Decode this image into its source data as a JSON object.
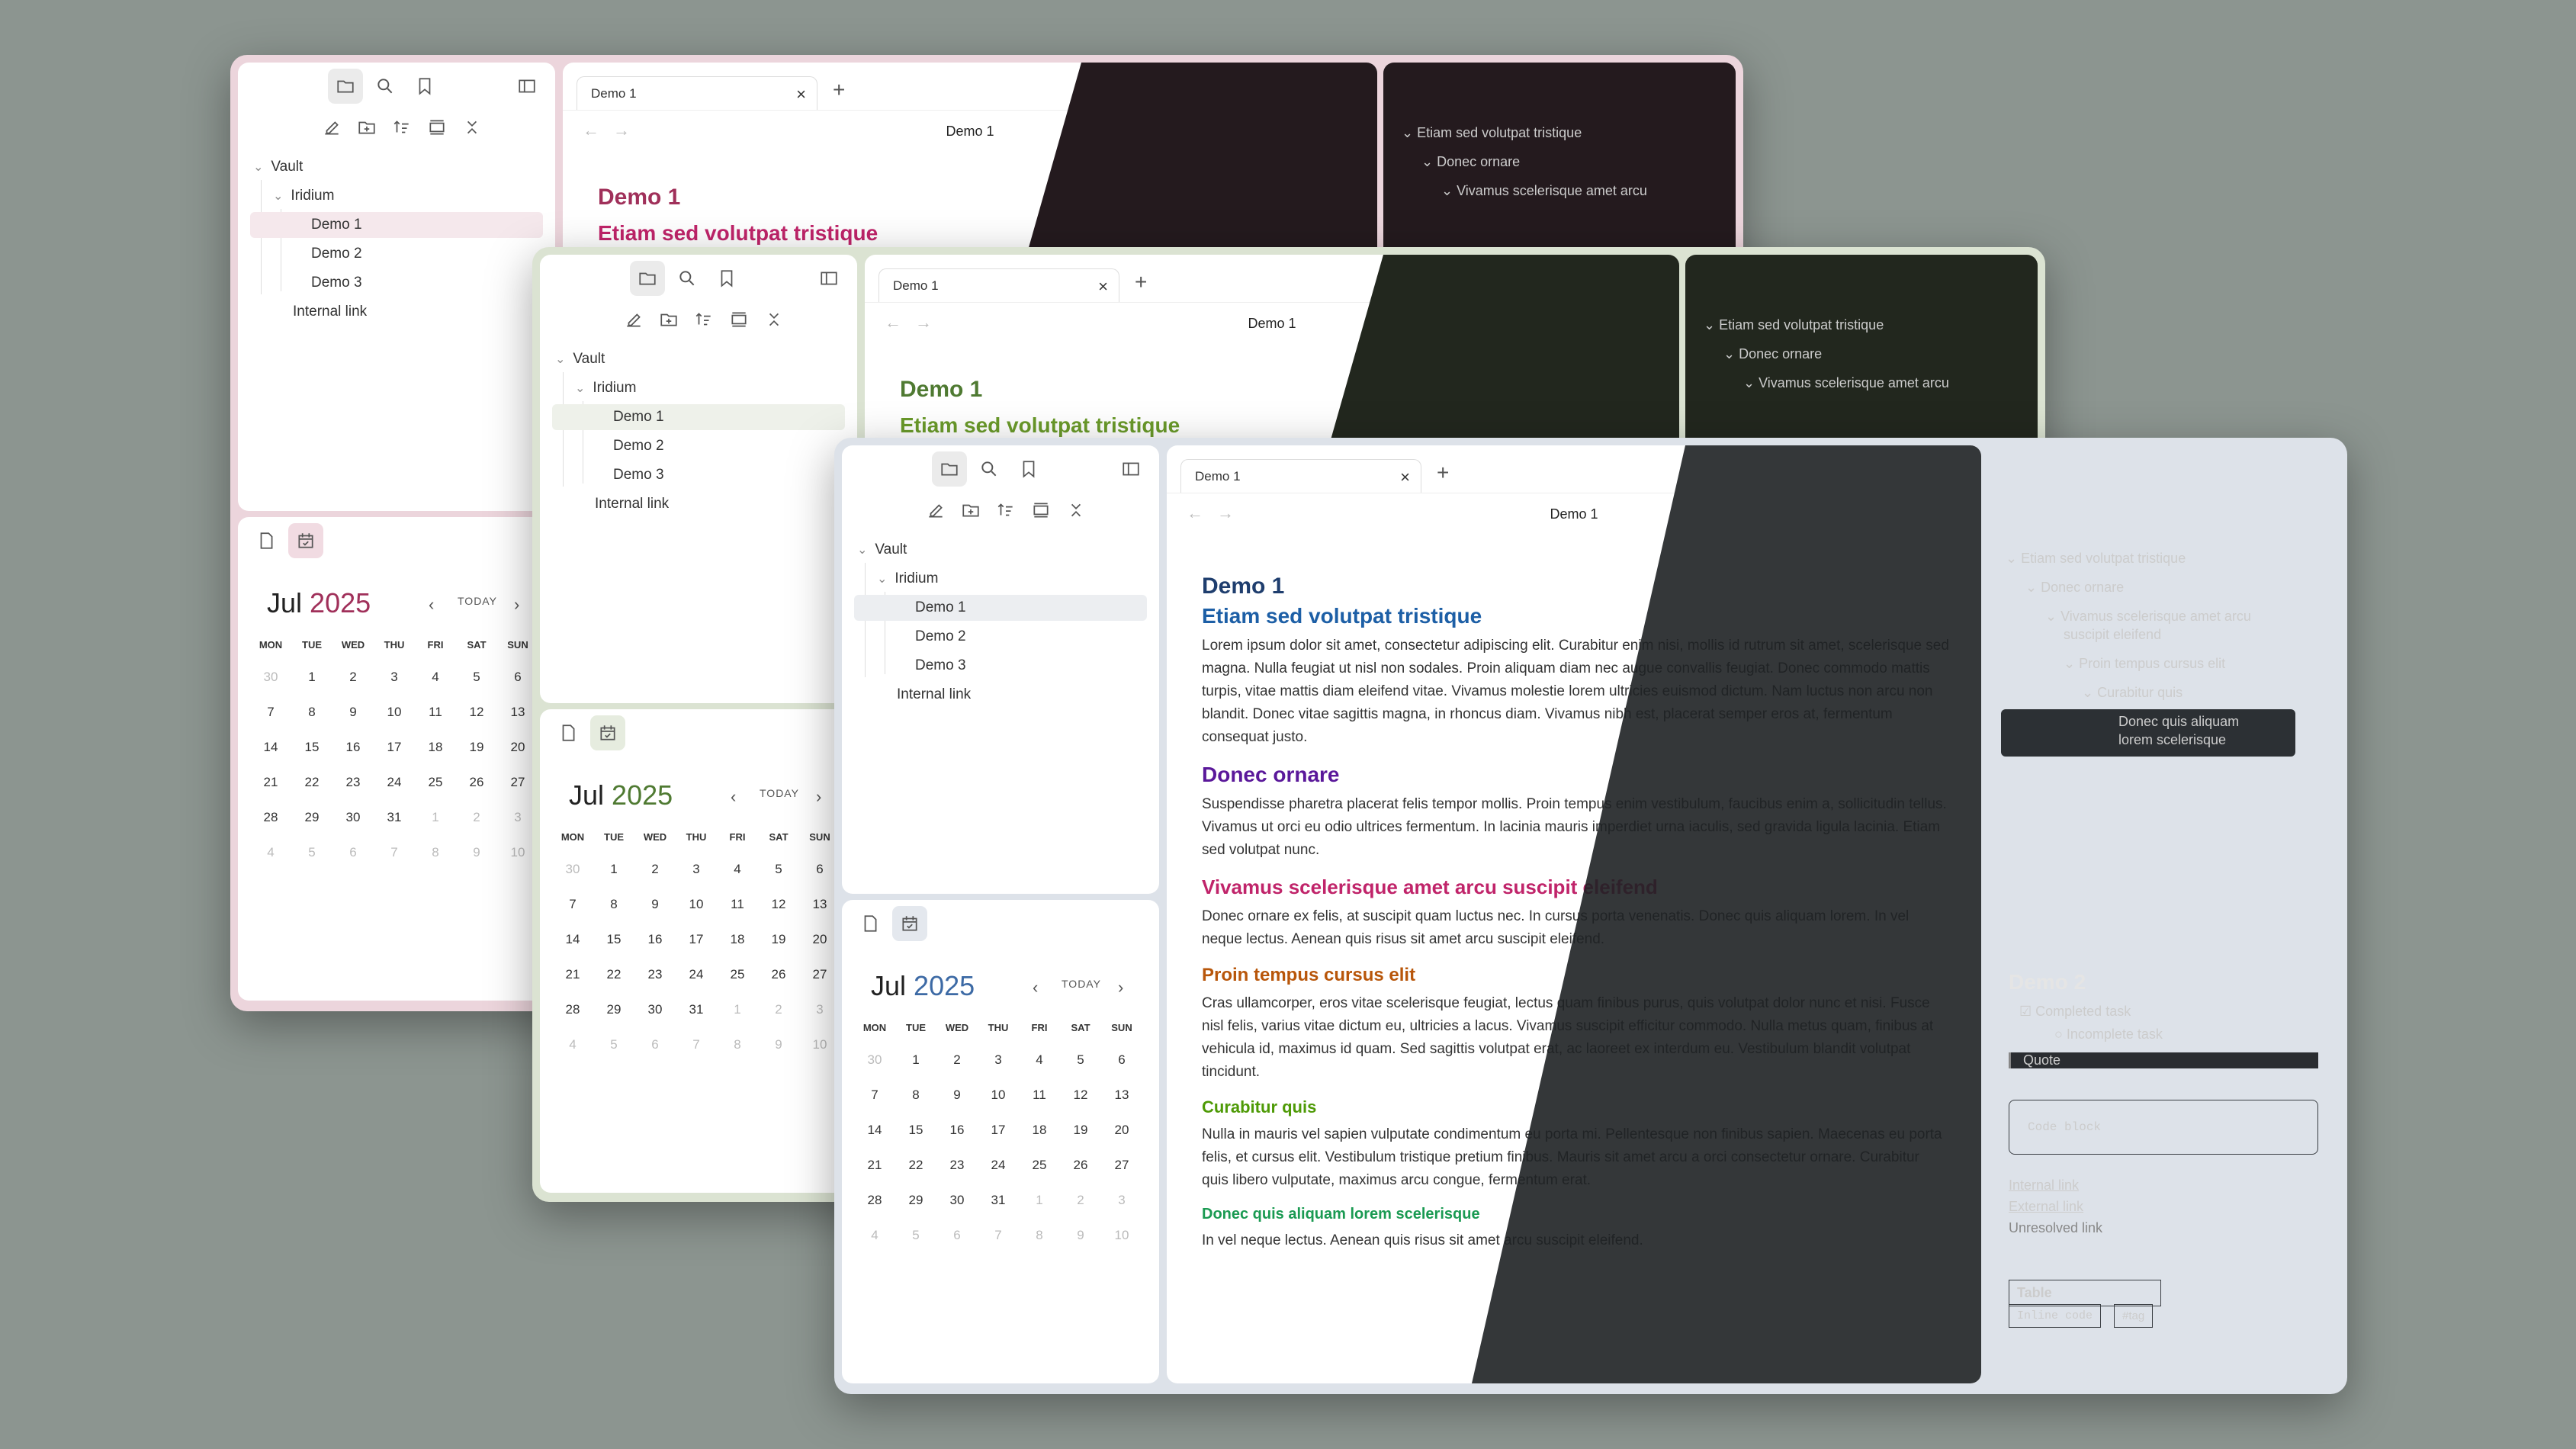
{
  "tab_label": "Demo 1",
  "crumb": "Demo 1",
  "tree": {
    "vault": "Vault",
    "iridium": "Iridium",
    "demo1": "Demo 1",
    "demo2": "Demo 2",
    "demo3": "Demo 3",
    "internal_link": "Internal link"
  },
  "calendar": {
    "month": "Jul",
    "year": "2025",
    "today": "TODAY",
    "days": [
      "MON",
      "TUE",
      "WED",
      "THU",
      "FRI",
      "SAT",
      "SUN"
    ],
    "weeks": [
      [
        "30",
        "1",
        "2",
        "3",
        "4",
        "5",
        "6"
      ],
      [
        "7",
        "8",
        "9",
        "10",
        "11",
        "12",
        "13"
      ],
      [
        "14",
        "15",
        "16",
        "17",
        "18",
        "19",
        "20"
      ],
      [
        "21",
        "22",
        "23",
        "24",
        "25",
        "26",
        "27"
      ],
      [
        "28",
        "29",
        "30",
        "31",
        "1",
        "2",
        "3"
      ],
      [
        "4",
        "5",
        "6",
        "7",
        "8",
        "9",
        "10"
      ]
    ]
  },
  "doc": {
    "title": "Demo 1",
    "h_etiam": "Etiam sed volutpat tristique",
    "p1": "Lorem ipsum dolor sit amet, consectetur adipiscing elit. Curabitur enim nisi, mollis id rutrum sit amet, scelerisque sed magna. Nulla feugiat ut nisl non sodales. Proin aliquam diam nec augue convallis feugiat. Donec commodo mattis turpis, vitae mattis diam eleifend vitae. Vivamus molestie lorem ultricies euismod dictum. Nam luctus non arcu non blandit. Donec vitae sagittis magna, in rhoncus diam. Vivamus nibh est, placerat semper eros at, fermentum consequat justo.",
    "h_donec": "Donec ornare",
    "p2": "Suspendisse pharetra placerat felis tempor mollis. Proin tempus enim vestibulum, faucibus enim a, sollicitudin tellus. Vivamus ut orci eu odio ultrices fermentum. In lacinia mauris imperdiet urna iaculis, sed gravida ligula lacinia. Etiam sed volutpat nunc.",
    "h_vivamus": "Vivamus scelerisque amet arcu suscipit eleifend",
    "p3": "Donec ornare ex felis, at suscipit quam luctus nec. In cursus porta venenatis. Donec quis aliquam lorem.  In vel neque lectus. Aenean quis risus sit amet arcu suscipit eleifend.",
    "h_proin": "Proin tempus cursus elit",
    "p4": "Cras ullamcorper, eros vitae scelerisque feugiat, lectus quam finibus purus, quis volutpat dolor nunc et nisi. Fusce nisl felis, varius vitae dictum eu, ultricies a lacus. Vivamus suscipit efficitur commodo. Nulla metus quam, finibus at vehicula id, maximus id quam. Sed sagittis volutpat erat, ac laoreet ex interdum eu. Vestibulum blandit volutpat tincidunt.",
    "h_curabitur": "Curabitur quis",
    "p5": "Nulla in mauris vel sapien vulputate condimentum eu porta mi. Pellentesque non finibus sapien. Maecenas eu porta felis, et cursus elit. Vestibulum tristique pretium finibus. Mauris sit amet arcu a orci consectetur ornare. Curabitur quis libero vulputate, maximus arcu congue, fermentum erat.",
    "h_donecquis": "Donec quis aliquam lorem scelerisque",
    "p6": " In vel neque lectus. Aenean quis risus sit amet arcu suscipit eleifend."
  },
  "outline": {
    "o1": "Etiam sed volutpat tristique",
    "o2": "Donec ornare",
    "o3a": "Vivamus scelerisque amet arcu",
    "o3b": "suscipit eleifend",
    "o4": "Proin tempus cursus elit",
    "o5": "Curabitur quis",
    "o6a": "Donec quis aliquam",
    "o6b": "lorem scelerisque",
    "o3trunc": "Vivamus scelerisque amet arcu"
  },
  "preview": {
    "title": "Demo 2",
    "completed": "Completed task",
    "incomplete": "Incomplete task",
    "quote": "Quote",
    "code": "Code block",
    "internal": "Internal link",
    "external": "External link",
    "unresolved": "Unresolved link",
    "table_header": "Table",
    "inline_code": "Inline code",
    "tag": "#tag"
  },
  "colors": {
    "w1_accent": "#a0305a",
    "w2_accent": "#4f7a32",
    "w3_title": "#1f3e6e",
    "w3_h2": "#1d5fa6",
    "w3_donec": "#5a189a",
    "w3_vivamus": "#c0246a",
    "w3_proin": "#b8560a",
    "w3_curabitur": "#4e9a06",
    "w3_donecquis": "#1a9a52"
  }
}
